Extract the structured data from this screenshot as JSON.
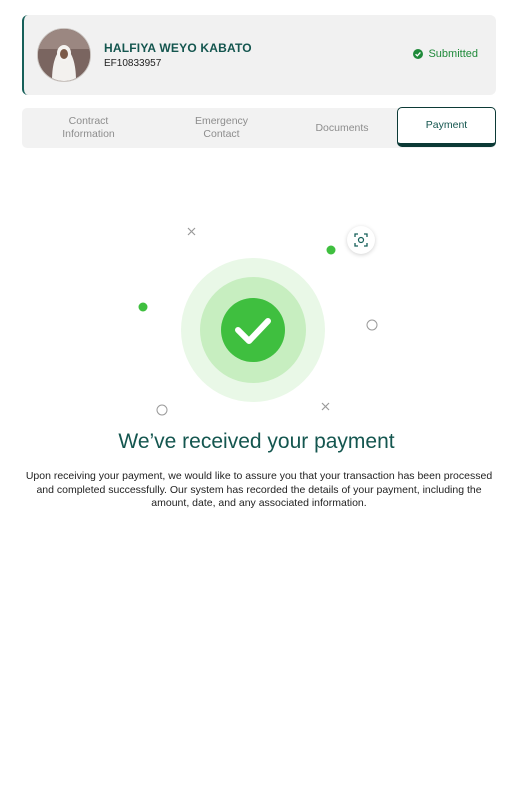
{
  "profile": {
    "name": "HALFIYA WEYO KABATO",
    "id": "EF10833957",
    "status": "Submitted"
  },
  "tabs": [
    {
      "label": "Contract\nInformation",
      "active": false
    },
    {
      "label": "Emergency\nContact",
      "active": false
    },
    {
      "label": "Documents",
      "active": false
    },
    {
      "label": "Payment",
      "active": true
    }
  ],
  "confirmation": {
    "title": "We’ve received your payment",
    "message": "Upon receiving your payment, we would like to assure you that your transaction has been processed and completed successfully. Our system has recorded the details of your payment, including the amount, date, and any associated information."
  },
  "icons": [
    "check-circle-icon",
    "scan-icon",
    "success-check-icon"
  ],
  "colors": {
    "primary": "#14564f",
    "success": "#3fbf3f",
    "status_green": "#1f8a3a"
  }
}
